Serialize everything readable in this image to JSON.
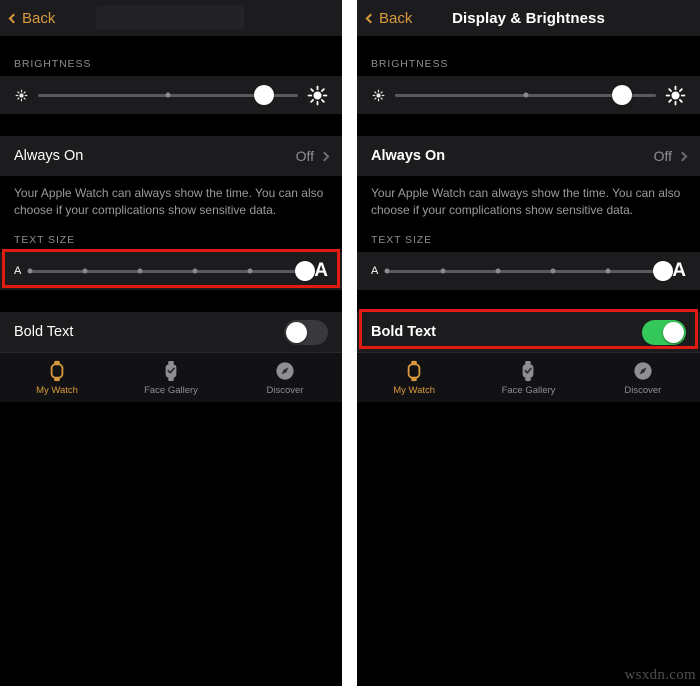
{
  "colors": {
    "accent": "#d99a3e",
    "toggle_on": "#34c759",
    "toggle_off": "#39393d",
    "highlight_box": "#e01b12",
    "row_bg": "#1c1c1e",
    "page_bg": "#000000",
    "secondary_text": "#8e8e93"
  },
  "left_panel": {
    "nav": {
      "back_label": "Back",
      "back_icon": "chevron-left-icon",
      "title": "",
      "title_redacted": true
    },
    "brightness": {
      "section_header": "BRIGHTNESS",
      "min_icon": "sun-small-icon",
      "max_icon": "sun-large-icon",
      "value_percent": 87,
      "ticks_percent": [
        50
      ]
    },
    "always_on": {
      "label": "Always On",
      "value": "Off",
      "chevron_icon": "chevron-right-icon"
    },
    "footnote": "Your Apple Watch can always show the time. You can also choose if your complications show sensitive data.",
    "text_size": {
      "section_header": "TEXT SIZE",
      "min_label": "A",
      "max_label": "A",
      "value_percent": 100,
      "ticks_percent": [
        0,
        20,
        40,
        60,
        80
      ]
    },
    "bold_text": {
      "label": "Bold Text",
      "state": "off"
    },
    "highlight_target": "text-size-slider-row",
    "tabs": [
      {
        "label": "My Watch",
        "icon": "apple-watch-icon",
        "active": true
      },
      {
        "label": "Face Gallery",
        "icon": "watch-face-icon",
        "active": false
      },
      {
        "label": "Discover",
        "icon": "compass-icon",
        "active": false
      }
    ]
  },
  "right_panel": {
    "nav": {
      "back_label": "Back",
      "back_icon": "chevron-left-icon",
      "title": "Display & Brightness",
      "title_redacted": false
    },
    "brightness": {
      "section_header": "BRIGHTNESS",
      "min_icon": "sun-small-icon",
      "max_icon": "sun-large-icon",
      "value_percent": 87,
      "ticks_percent": [
        50
      ]
    },
    "always_on": {
      "label": "Always On",
      "value": "Off",
      "chevron_icon": "chevron-right-icon"
    },
    "footnote": "Your Apple Watch can always show the time. You can also choose if your complications show sensitive data.",
    "text_size": {
      "section_header": "TEXT SIZE",
      "min_label": "A",
      "max_label": "A",
      "value_percent": 100,
      "ticks_percent": [
        0,
        20,
        40,
        60,
        80
      ]
    },
    "bold_text": {
      "label": "Bold Text",
      "state": "on"
    },
    "highlight_target": "bold-text-row",
    "tabs": [
      {
        "label": "My Watch",
        "icon": "apple-watch-icon",
        "active": true
      },
      {
        "label": "Face Gallery",
        "icon": "watch-face-icon",
        "active": false
      },
      {
        "label": "Discover",
        "icon": "compass-icon",
        "active": false
      }
    ],
    "watermark": "wsxdn.com"
  }
}
